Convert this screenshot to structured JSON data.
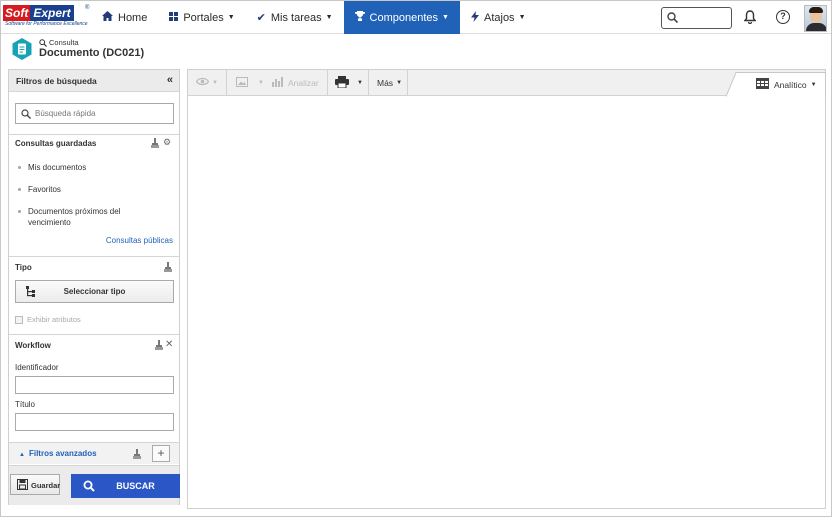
{
  "brand": {
    "soft": "Soft",
    "expert": "Expert",
    "reg": "®",
    "tagline": "Software for Performance Excellence"
  },
  "nav": {
    "home": "Home",
    "portales": "Portales",
    "tareas": "Mis tareas",
    "componentes": "Componentes",
    "atajos": "Atajos"
  },
  "header": {
    "crumb": "Consulta",
    "title": "Documento (DC021)"
  },
  "left": {
    "title": "Filtros de búsqueda",
    "quick_placeholder": "Búsqueda rápida",
    "saved": {
      "title": "Consultas guardadas",
      "items": [
        "Mis documentos",
        "Favoritos",
        "Documentos próximos del vencimiento"
      ],
      "public_link": "Consultas públicas"
    },
    "tipo": {
      "title": "Tipo",
      "button": "Seleccionar tipo",
      "checkbox": "Exhibir atributos"
    },
    "workflow": {
      "title": "Workflow",
      "id_label": "Identificador",
      "title_label": "Título"
    },
    "advanced": "Filtros avanzados",
    "save_button": "Guardar",
    "search_button": "BUSCAR"
  },
  "toolbar": {
    "analyze": "Analizar",
    "more": "Más",
    "view": "Analítico"
  },
  "colors": {
    "accent": "#1f62b8",
    "search_button": "#2a56c6",
    "brand_red": "#d71920",
    "brand_blue": "#1a3f8c"
  }
}
